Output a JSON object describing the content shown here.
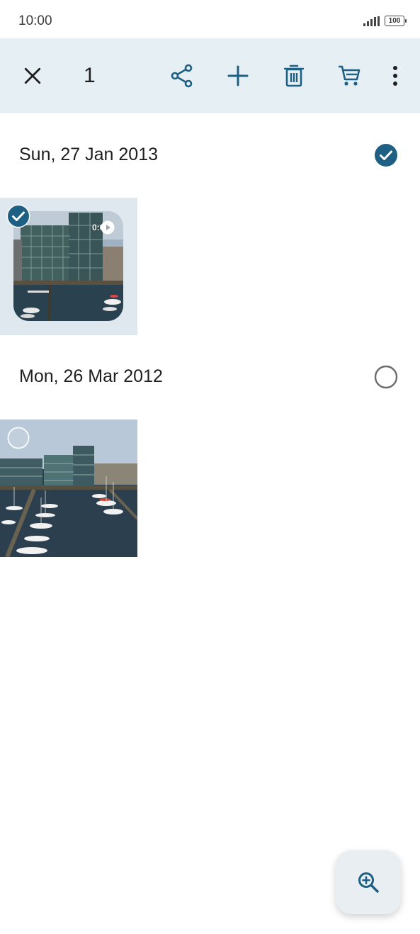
{
  "status_bar": {
    "time": "10:00",
    "battery": "100"
  },
  "toolbar": {
    "selected_count": "1",
    "icons": [
      "close-icon",
      "share-icon",
      "add-icon",
      "delete-icon",
      "cart-icon",
      "more-vert-icon"
    ]
  },
  "sections": [
    {
      "date": "Sun, 27 Jan 2013",
      "selected": true,
      "items": [
        {
          "type": "video",
          "duration": "0:05",
          "selected": true
        }
      ]
    },
    {
      "date": "Mon, 26 Mar 2012",
      "selected": false,
      "items": [
        {
          "type": "photo",
          "selected": false
        }
      ]
    }
  ],
  "colors": {
    "accent": "#1e6083",
    "toolbar_bg": "#e6f0f4",
    "selected_tile_bg": "#dfe7ef"
  },
  "fab": {
    "icon": "zoom-in-icon"
  }
}
